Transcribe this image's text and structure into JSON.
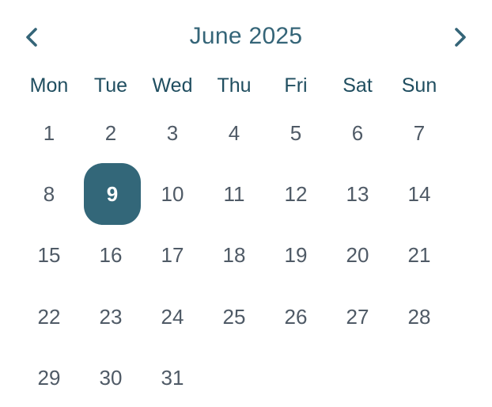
{
  "header": {
    "title": "June 2025",
    "prev_icon": "chevron-left-icon",
    "next_icon": "chevron-right-icon"
  },
  "weekdays": [
    "Mon",
    "Tue",
    "Wed",
    "Thu",
    "Fri",
    "Sat",
    "Sun"
  ],
  "days": [
    "1",
    "2",
    "3",
    "4",
    "5",
    "6",
    "7",
    "8",
    "9",
    "10",
    "11",
    "12",
    "13",
    "14",
    "15",
    "16",
    "17",
    "18",
    "19",
    "20",
    "21",
    "22",
    "23",
    "24",
    "25",
    "26",
    "27",
    "28",
    "29",
    "30",
    "31"
  ],
  "selected_day": "9",
  "colors": {
    "accent": "#336779",
    "title": "#356578",
    "weekday": "#204e60",
    "day_text": "#4f5a66",
    "selected_text": "#ffffff",
    "background": "#ffffff"
  }
}
